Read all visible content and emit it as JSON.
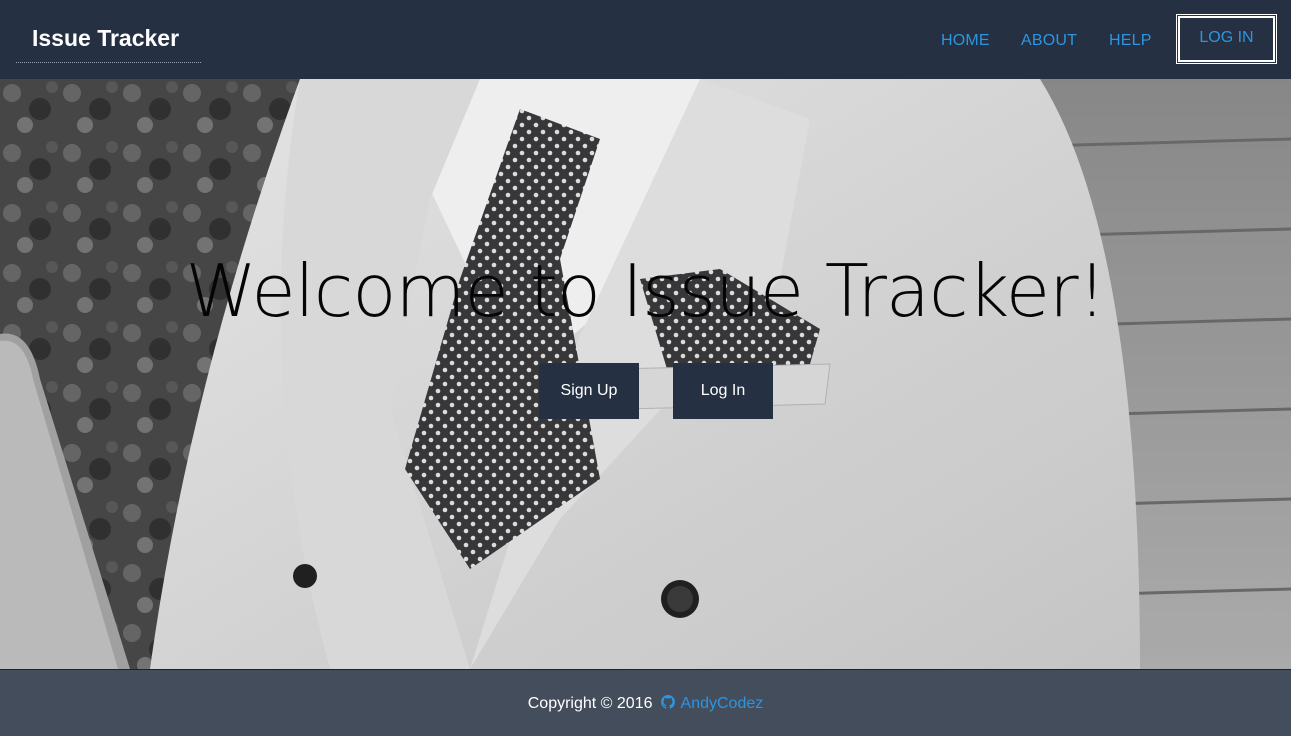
{
  "navbar": {
    "brand": "Issue Tracker",
    "links": [
      {
        "label": "HOME"
      },
      {
        "label": "ABOUT"
      },
      {
        "label": "HELP"
      }
    ],
    "login_label": "LOG IN",
    "background_color": "#253142",
    "link_color": "#2d95e0"
  },
  "hero": {
    "title": "Welcome to Issue Tracker!",
    "signup_label": "Sign Up",
    "login_label": "Log In",
    "background_image": "grayscale photo of man in white double-breasted suit with polka-dot tie"
  },
  "footer": {
    "copyright": "Copyright © 2016",
    "author_icon": "github-icon",
    "author": "AndyCodez",
    "background_color": "#434d5c"
  }
}
